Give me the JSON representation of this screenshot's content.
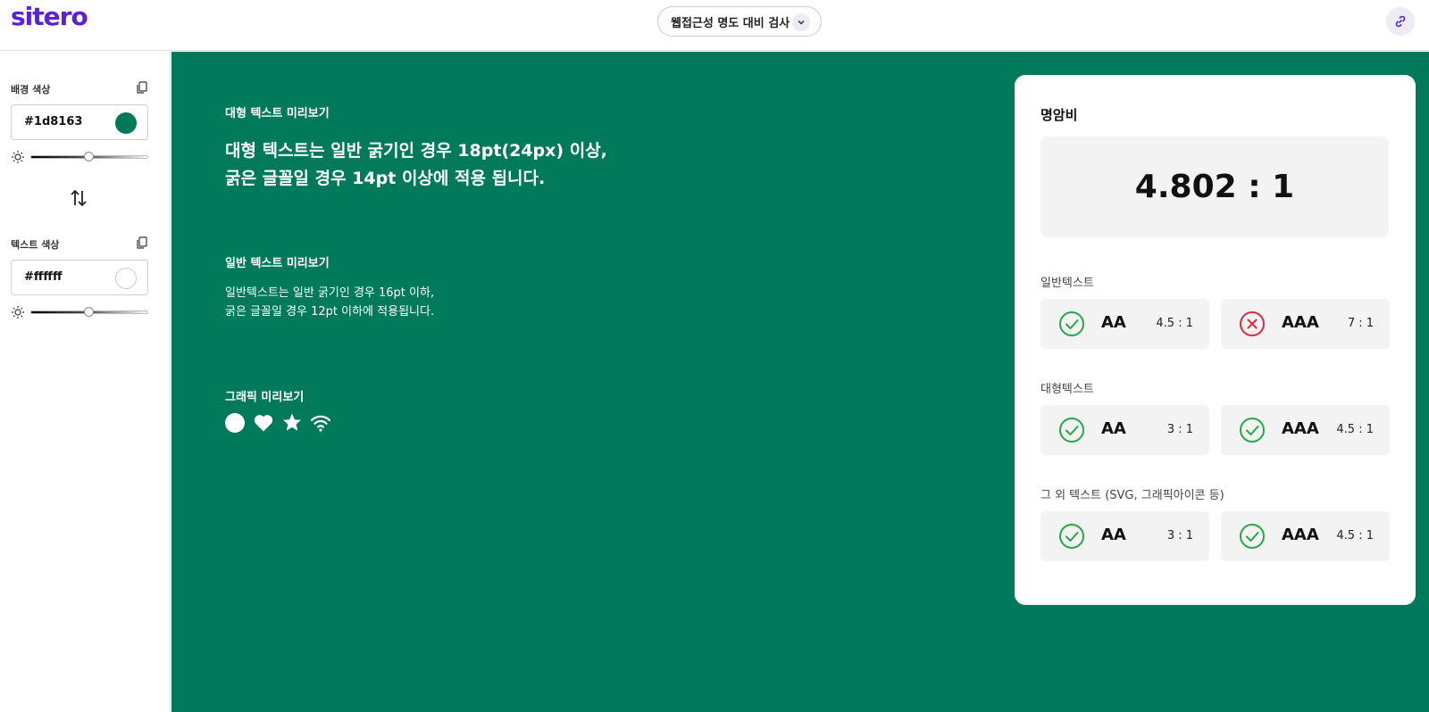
{
  "header": {
    "logo": "sitero",
    "tool_select": "웹접근성 명도 대비 검사"
  },
  "sidebar": {
    "background": {
      "label": "배경 색상",
      "value": "#1d8163",
      "swatch": "#00795a",
      "brightness": 0.5
    },
    "text": {
      "label": "텍스트 색상",
      "value": "#ffffff",
      "swatch": "#ffffff",
      "brightness": 0.5
    }
  },
  "preview": {
    "bg_color": "#007a5a",
    "large_heading": "대형 텍스트 미리보기",
    "large_line1": "대형 텍스트는 일반 굵기인 경우 18pt(24px) 이상,",
    "large_line2": "굵은 글꼴일 경우 14pt 이상에 적용 됩니다.",
    "normal_heading": "일반 텍스트 미리보기",
    "normal_line1": "일반텍스트는 일반 굵기인 경우 16pt 이하,",
    "normal_line2": "굵은 글꼴일 경우 12pt 이하에 적용됩니다.",
    "graphic_heading": "그래픽 미리보기",
    "graphic_icons": [
      "circle-icon",
      "heart-icon",
      "star-icon",
      "wifi-icon"
    ]
  },
  "result": {
    "title": "명암비",
    "ratio": "4.802 : 1",
    "groups": [
      {
        "label": "일반텍스트",
        "items": [
          {
            "level": "AA",
            "required": "4.5 : 1",
            "pass": true
          },
          {
            "level": "AAA",
            "required": "7 : 1",
            "pass": false
          }
        ]
      },
      {
        "label": "대형텍스트",
        "items": [
          {
            "level": "AA",
            "required": "3 : 1",
            "pass": true
          },
          {
            "level": "AAA",
            "required": "4.5 : 1",
            "pass": true
          }
        ]
      },
      {
        "label": "그 외 텍스트 (SVG, 그래픽아이콘 등)",
        "items": [
          {
            "level": "AA",
            "required": "3 : 1",
            "pass": true
          },
          {
            "level": "AAA",
            "required": "4.5 : 1",
            "pass": true
          }
        ]
      }
    ],
    "pass_color": "#22a845",
    "fail_color": "#e0283c"
  }
}
